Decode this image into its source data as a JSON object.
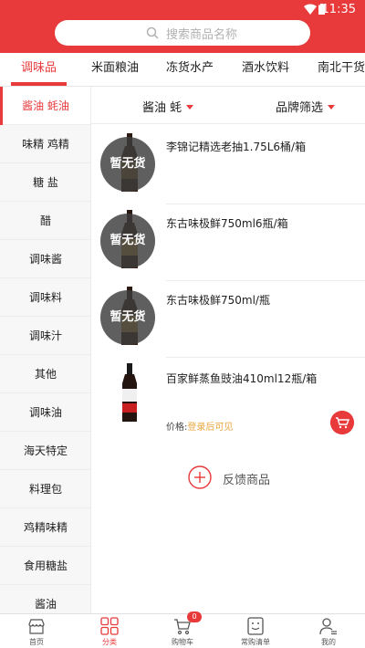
{
  "status_bar": {
    "time": "11:35"
  },
  "search": {
    "placeholder": "搜索商品名称"
  },
  "category_tabs": [
    {
      "label": "调味品",
      "active": true
    },
    {
      "label": "米面粮油",
      "active": false
    },
    {
      "label": "冻货水产",
      "active": false
    },
    {
      "label": "酒水饮料",
      "active": false
    },
    {
      "label": "南北干货",
      "active": false
    }
  ],
  "sidebar": {
    "items": [
      {
        "label": "酱油 蚝油",
        "active": true
      },
      {
        "label": "味精 鸡精"
      },
      {
        "label": "糖 盐"
      },
      {
        "label": "醋"
      },
      {
        "label": "调味酱"
      },
      {
        "label": "调味料"
      },
      {
        "label": "调味汁"
      },
      {
        "label": "其他"
      },
      {
        "label": "调味油"
      },
      {
        "label": "海天特定"
      },
      {
        "label": "料理包"
      },
      {
        "label": "鸡精味精"
      },
      {
        "label": "食用糖盐"
      },
      {
        "label": "酱油"
      }
    ]
  },
  "filters": {
    "category": "酱油 蚝",
    "brand": "品牌筛选"
  },
  "products": [
    {
      "name": "李锦记精选老抽1.75L6桶/箱",
      "sold_out": "暂无货"
    },
    {
      "name": "东古味极鲜750ml6瓶/箱",
      "sold_out": "暂无货"
    },
    {
      "name": "东古味极鲜750ml/瓶",
      "sold_out": "暂无货"
    },
    {
      "name": "百家鲜蒸鱼豉油410ml12瓶/箱",
      "price_label": "价格:",
      "price_value": "登录后可见"
    }
  ],
  "feedback": {
    "label": "反馈商品"
  },
  "bottom_nav": [
    {
      "label": "首页",
      "icon": "store-icon"
    },
    {
      "label": "分类",
      "icon": "grid-icon",
      "active": true
    },
    {
      "label": "购物车",
      "icon": "cart-icon",
      "badge": "0"
    },
    {
      "label": "常购清单",
      "icon": "list-icon"
    },
    {
      "label": "我的",
      "icon": "user-icon"
    }
  ],
  "colors": {
    "accent": "#e8393b",
    "login_prompt": "#e8a53b"
  }
}
